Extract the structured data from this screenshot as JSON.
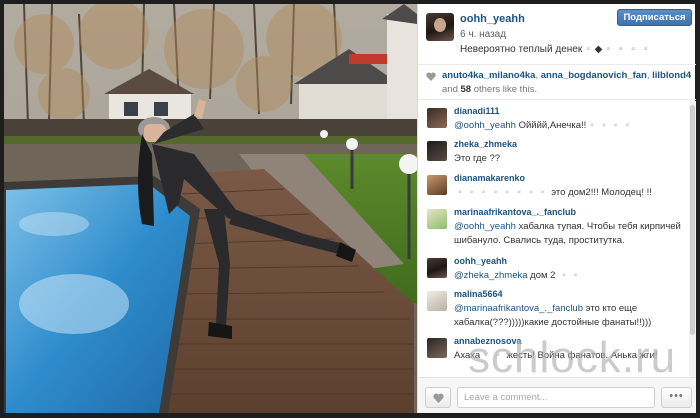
{
  "post": {
    "username": "oohh_yeahh",
    "time": "6 ч. назад",
    "caption": "Невероятно теплый денек▫️◆▫️▫️▫️▫️",
    "follow_label": "Подписаться"
  },
  "likes": {
    "users": [
      "anuto4ka_milano4ka",
      "anna_bogdanovich_fan",
      "lilblond4"
    ],
    "and_label": "and",
    "others_count": "58",
    "others_label": "others like this."
  },
  "comments": [
    {
      "user": "dianadi111",
      "mention": "@oohh_yeahh",
      "text": " Ойййй,Анечка!!▫️▫️▫️▫️"
    },
    {
      "user": "zheka_zhmeka",
      "mention": "",
      "text": "Это где ??"
    },
    {
      "user": "dianamakarenko",
      "mention": "",
      "text": "▫️▫️▫️▫️▫️▫️▫️▫️ это дом2!!! Молодец! !!"
    },
    {
      "user": "marinaafrikantova_._fanclub",
      "mention": "@oohh_yeahh",
      "text": " хабалка тупая. Чтобы тебя кирпичей шибануло. Свались туда, проститутка."
    },
    {
      "user": "oohh_yeahh",
      "mention": "@zheka_zhmeka",
      "text": " дом 2 ▫️▫️"
    },
    {
      "user": "malina5664",
      "mention": "@marinaafrikantova_._fanclub",
      "text": " это кто еще хабалка(???)))))какие достойные фанаты!!)))"
    },
    {
      "user": "annabeznosova",
      "mention": "",
      "text": "Ахаха▫️▫️ жесть! Война фанатов. Анька жги!"
    }
  ],
  "footer": {
    "comment_placeholder": "Leave a comment...",
    "more_label": "•••"
  },
  "watermark": "schlock.ru",
  "colors": {
    "link": "#1c5380",
    "follow_button": "#3e73ab"
  }
}
